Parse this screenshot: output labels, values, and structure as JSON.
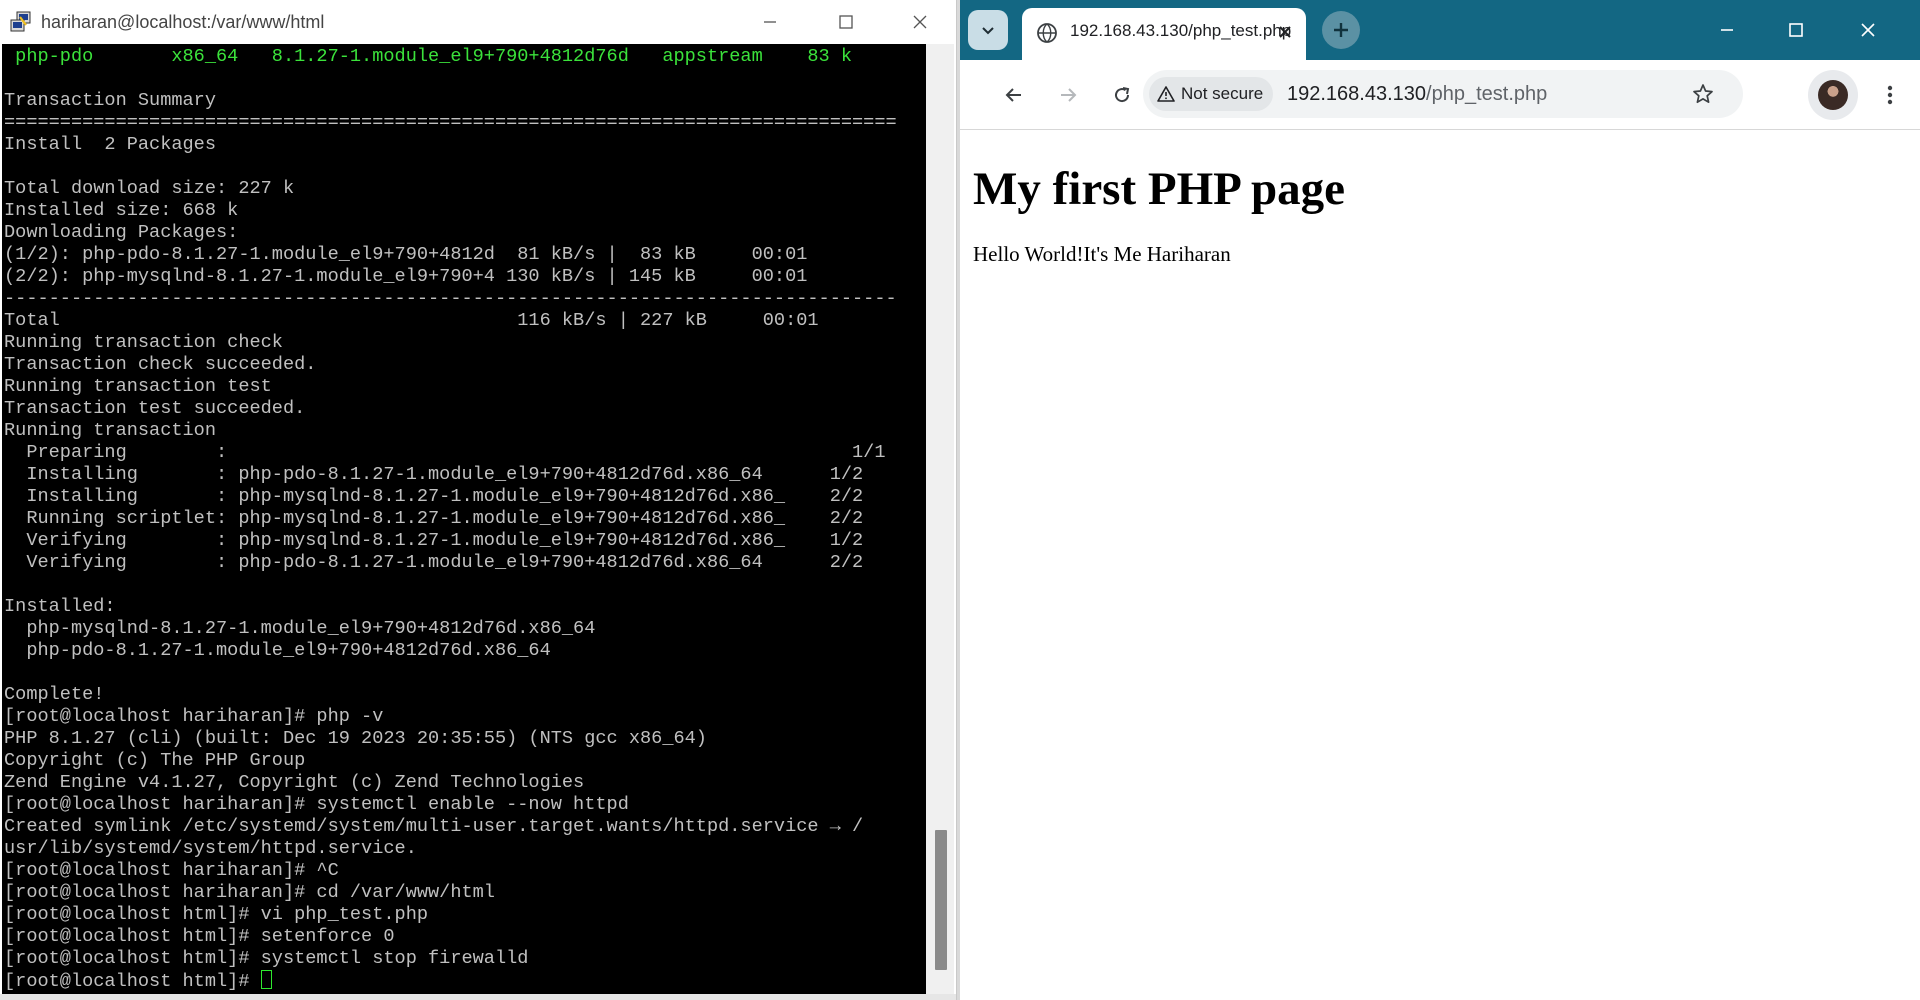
{
  "terminal_window": {
    "title": "hariharan@localhost:/var/www/html",
    "lines": [
      " php-pdo       x86_64   8.1.27-1.module_el9+790+4812d76d   appstream    83 k",
      "",
      "Transaction Summary",
      "================================================================================",
      "Install  2 Packages",
      "",
      "Total download size: 227 k",
      "Installed size: 668 k",
      "Downloading Packages:",
      "(1/2): php-pdo-8.1.27-1.module_el9+790+4812d  81 kB/s |  83 kB     00:01",
      "(2/2): php-mysqlnd-8.1.27-1.module_el9+790+4 130 kB/s | 145 kB     00:01",
      "--------------------------------------------------------------------------------",
      "Total                                         116 kB/s | 227 kB     00:01",
      "Running transaction check",
      "Transaction check succeeded.",
      "Running transaction test",
      "Transaction test succeeded.",
      "Running transaction",
      "  Preparing        :                                                        1/1",
      "  Installing       : php-pdo-8.1.27-1.module_el9+790+4812d76d.x86_64      1/2",
      "  Installing       : php-mysqlnd-8.1.27-1.module_el9+790+4812d76d.x86_    2/2",
      "  Running scriptlet: php-mysqlnd-8.1.27-1.module_el9+790+4812d76d.x86_    2/2",
      "  Verifying        : php-mysqlnd-8.1.27-1.module_el9+790+4812d76d.x86_    1/2",
      "  Verifying        : php-pdo-8.1.27-1.module_el9+790+4812d76d.x86_64      2/2",
      "",
      "Installed:",
      "  php-mysqlnd-8.1.27-1.module_el9+790+4812d76d.x86_64",
      "  php-pdo-8.1.27-1.module_el9+790+4812d76d.x86_64",
      "",
      "Complete!",
      "[root@localhost hariharan]# php -v",
      "PHP 8.1.27 (cli) (built: Dec 19 2023 20:35:55) (NTS gcc x86_64)",
      "Copyright (c) The PHP Group",
      "Zend Engine v4.1.27, Copyright (c) Zend Technologies",
      "[root@localhost hariharan]# systemctl enable --now httpd",
      "Created symlink /etc/systemd/system/multi-user.target.wants/httpd.service → /",
      "usr/lib/systemd/system/httpd.service.",
      "[root@localhost hariharan]# ^C",
      "[root@localhost hariharan]# cd /var/www/html",
      "[root@localhost html]# vi php_test.php",
      "[root@localhost html]# setenforce 0",
      "[root@localhost html]# systemctl stop firewalld"
    ],
    "prompt": "[root@localhost html]# ",
    "highlight_color": "#3be23b",
    "text_color": "#c0c0c0",
    "background_color": "#000000"
  },
  "browser": {
    "tab_title": "192.168.43.130/php_test.php",
    "security_label": "Not secure",
    "url_host": "192.168.43.130",
    "url_path": "/php_test.php",
    "tabstrip_color": "#136783",
    "icons": [
      "tab-search-icon",
      "globe-icon",
      "close-icon",
      "plus-icon",
      "minimize-icon",
      "maximize-icon",
      "close-icon",
      "back-arrow-icon",
      "forward-arrow-icon",
      "reload-icon",
      "warning-icon",
      "star-icon",
      "avatar",
      "kebab-menu-icon"
    ]
  },
  "page": {
    "heading": "My first PHP page",
    "paragraph": "Hello World!It's Me Hariharan"
  }
}
